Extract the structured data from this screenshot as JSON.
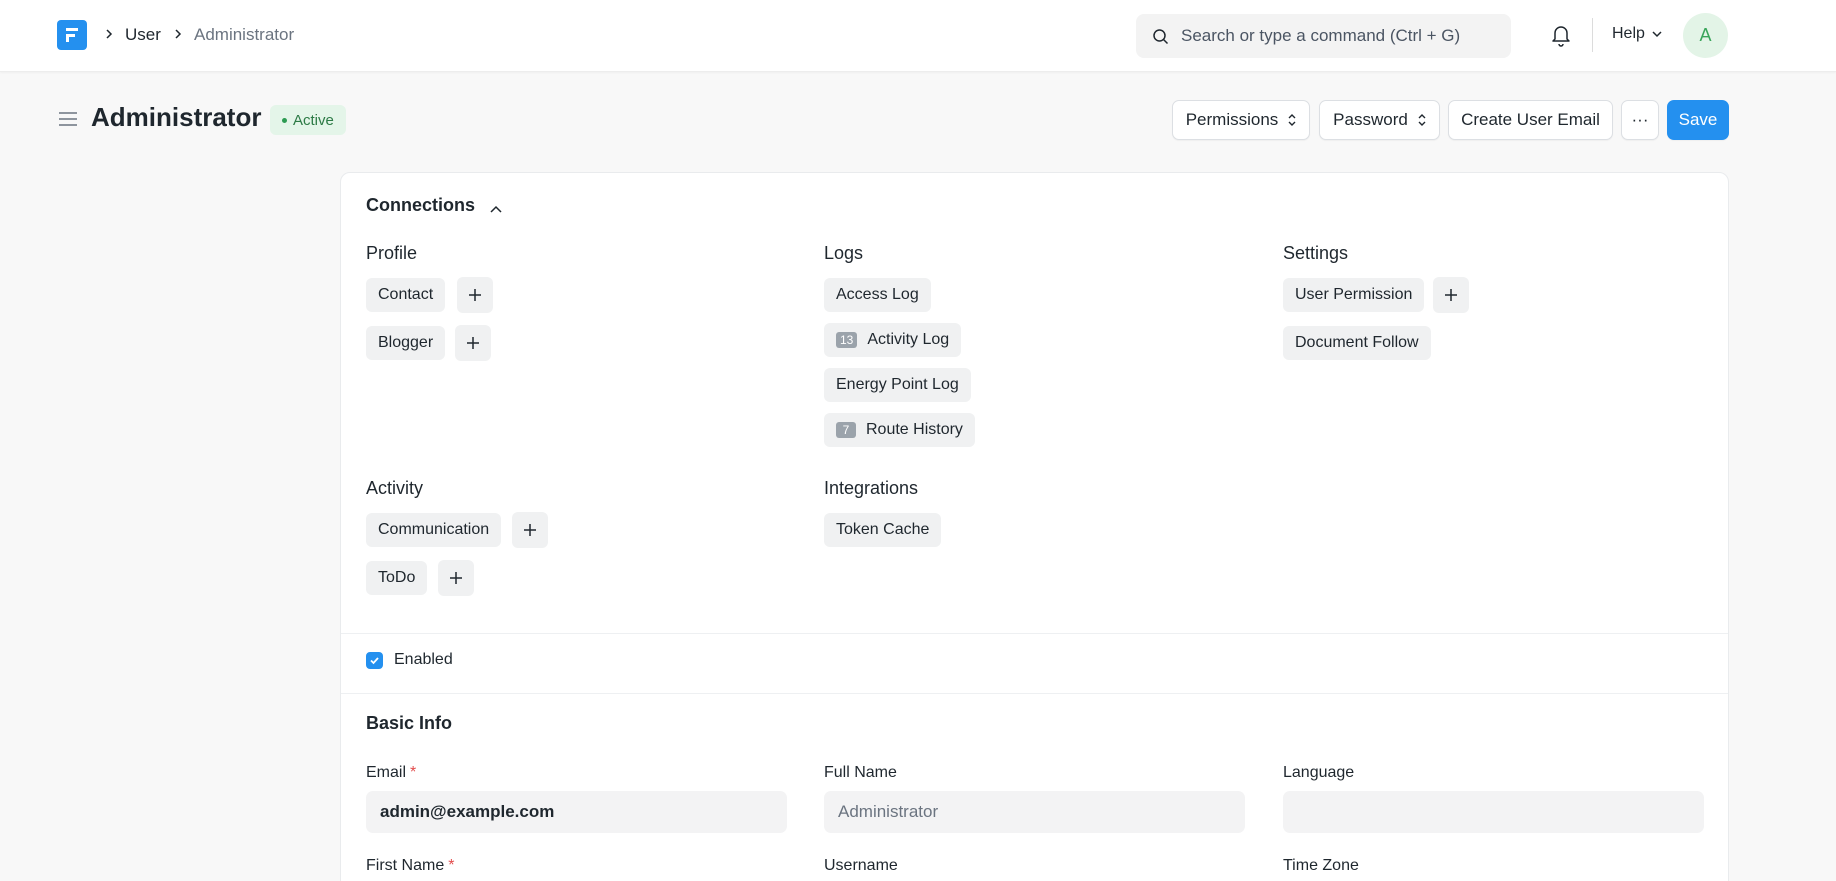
{
  "navbar": {
    "breadcrumbs": [
      "User",
      "Administrator"
    ],
    "search_placeholder": "Search or type a command (Ctrl + G)",
    "help_label": "Help",
    "avatar_initial": "A"
  },
  "page": {
    "title": "Administrator",
    "status": "Active"
  },
  "actions": {
    "permissions": "Permissions",
    "password": "Password",
    "create_user_email": "Create User Email",
    "more": "···",
    "save": "Save"
  },
  "connections": {
    "title": "Connections",
    "groups": {
      "profile": {
        "title": "Profile",
        "items": [
          "Contact",
          "Blogger"
        ]
      },
      "logs": {
        "title": "Logs",
        "items": [
          "Access Log",
          "Activity Log",
          "Energy Point Log",
          "Route History"
        ],
        "counts": {
          "activity_log": "13",
          "route_history": "7"
        }
      },
      "settings": {
        "title": "Settings",
        "items": [
          "User Permission",
          "Document Follow"
        ]
      },
      "activity": {
        "title": "Activity",
        "items": [
          "Communication",
          "ToDo"
        ]
      },
      "integrations": {
        "title": "Integrations",
        "items": [
          "Token Cache"
        ]
      }
    }
  },
  "enabled": {
    "label": "Enabled",
    "checked": true
  },
  "basic_info": {
    "title": "Basic Info",
    "fields": {
      "email": {
        "label": "Email",
        "value": "admin@example.com"
      },
      "full_name": {
        "label": "Full Name",
        "value": "Administrator"
      },
      "language": {
        "label": "Language",
        "value": ""
      },
      "first_name": {
        "label": "First Name"
      },
      "username": {
        "label": "Username"
      },
      "time_zone": {
        "label": "Time Zone"
      }
    }
  },
  "colors": {
    "primary": "#2490ef",
    "active_badge_bg": "#e4f5e9",
    "active_badge_text": "#2c7a45",
    "required": "#e24c4c"
  }
}
